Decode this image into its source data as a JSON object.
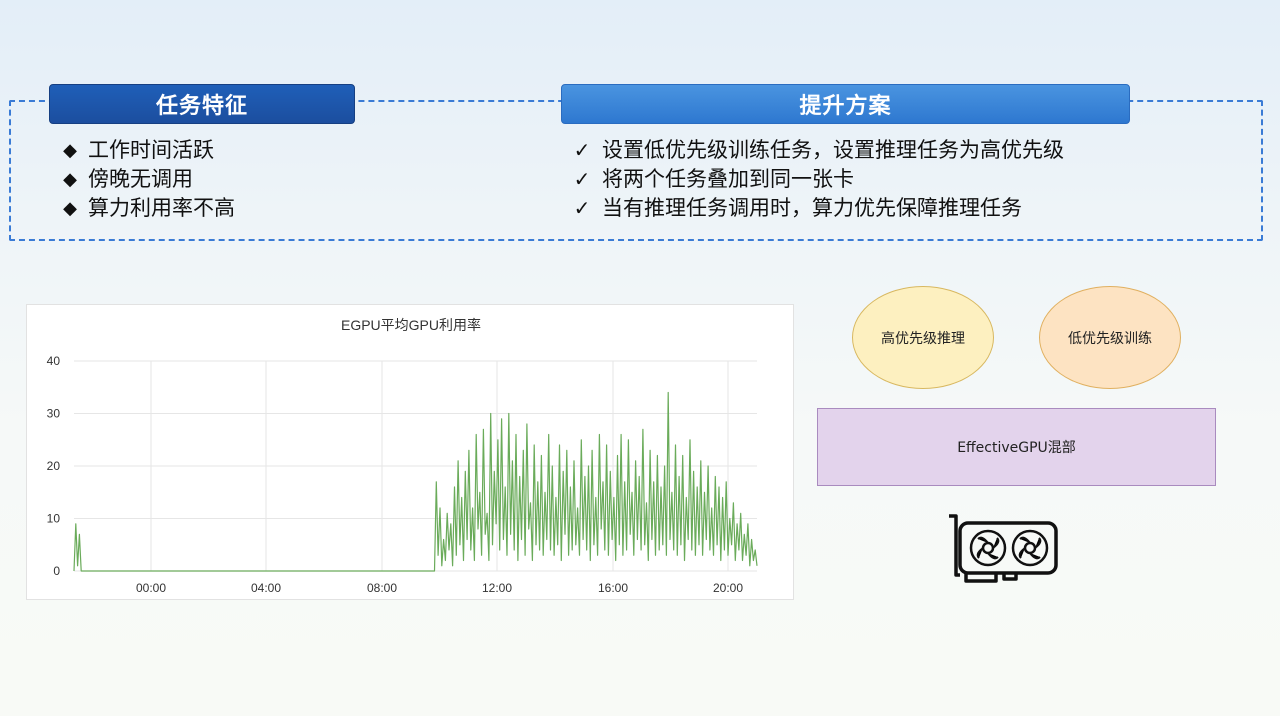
{
  "left_section": {
    "title": "任务特征",
    "items": [
      "工作时间活跃",
      "傍晚无调用",
      "算力利用率不高"
    ]
  },
  "right_section": {
    "title": "提升方案",
    "items": [
      "设置低优先级训练任务，设置推理任务为高优先级",
      "将两个任务叠加到同一张卡",
      "当有推理任务调用时，算力优先保障推理任务"
    ]
  },
  "chart_data": {
    "type": "line",
    "title": "EGPU平均GPU利用率",
    "xlabel": "",
    "ylabel": "",
    "ylim": [
      0,
      40
    ],
    "y_ticks": [
      "0",
      "10",
      "20",
      "30",
      "40"
    ],
    "x_ticks": [
      "00:00",
      "04:00",
      "08:00",
      "12:00",
      "16:00",
      "20:00"
    ],
    "grid": true,
    "series_color": "#6aab5a",
    "series": [
      {
        "values": [
          0,
          9,
          1,
          7,
          0,
          0,
          0,
          0,
          0,
          0,
          0,
          0,
          0,
          0,
          0,
          0,
          0,
          0,
          0,
          0,
          0,
          0,
          0,
          0,
          0,
          0,
          0,
          0,
          0,
          0,
          0,
          0,
          0,
          0,
          0,
          0,
          0,
          0,
          0,
          0,
          0,
          0,
          0,
          0,
          0,
          0,
          0,
          0,
          0,
          0,
          0,
          0,
          0,
          0,
          0,
          0,
          0,
          0,
          0,
          0,
          0,
          0,
          0,
          0,
          0,
          0,
          0,
          0,
          0,
          0,
          0,
          0,
          0,
          0,
          0,
          0,
          0,
          0,
          0,
          0,
          0,
          0,
          0,
          0,
          0,
          0,
          0,
          0,
          0,
          0,
          0,
          0,
          0,
          0,
          0,
          0,
          0,
          0,
          0,
          0,
          0,
          0,
          0,
          0,
          0,
          0,
          0,
          0,
          0,
          0,
          0,
          0,
          0,
          0,
          0,
          0,
          0,
          0,
          0,
          0,
          0,
          0,
          0,
          0,
          0,
          0,
          0,
          0,
          0,
          0,
          0,
          0,
          0,
          0,
          0,
          0,
          0,
          0,
          0,
          0,
          0,
          0,
          0,
          0,
          0,
          0,
          0,
          0,
          0,
          0,
          0,
          0,
          0,
          0,
          0,
          0,
          0,
          0,
          0,
          0,
          0,
          0,
          0,
          0,
          0,
          0,
          0,
          0,
          0,
          0,
          0,
          0,
          0,
          0,
          0,
          0,
          0,
          0,
          0,
          0,
          0,
          0,
          0,
          0,
          0,
          0,
          0,
          0,
          0,
          0,
          0,
          0,
          0,
          0,
          0,
          0,
          0,
          0,
          0,
          0,
          17,
          3,
          12,
          1,
          6,
          2,
          11,
          4,
          9,
          1,
          16,
          3,
          21,
          5,
          14,
          2,
          19,
          6,
          23,
          4,
          12,
          2,
          26,
          8,
          15,
          3,
          27,
          7,
          11,
          2,
          30,
          5,
          19,
          9,
          25,
          4,
          29,
          6,
          16,
          3,
          30,
          7,
          21,
          4,
          26,
          2,
          18,
          6,
          23,
          3,
          28,
          8,
          13,
          2,
          24,
          5,
          17,
          4,
          22,
          3,
          15,
          6,
          26,
          4,
          20,
          3,
          14,
          5,
          24,
          2,
          19,
          7,
          23,
          3,
          16,
          4,
          21,
          5,
          12,
          3,
          25,
          6,
          18,
          4,
          20,
          2,
          23,
          5,
          14,
          3,
          26,
          8,
          17,
          4,
          24,
          3,
          19,
          6,
          14,
          2,
          22,
          5,
          26,
          3,
          17,
          4,
          25,
          7,
          15,
          3,
          21,
          6,
          18,
          4,
          27,
          5,
          13,
          2,
          23,
          6,
          17,
          3,
          22,
          4,
          16,
          5,
          20,
          3,
          34,
          6,
          15,
          4,
          24,
          3,
          18,
          5,
          22,
          2,
          14,
          6,
          25,
          4,
          19,
          3,
          16,
          5,
          21,
          3,
          15,
          6,
          20,
          4,
          12,
          3,
          18,
          5,
          16,
          2,
          14,
          4,
          17,
          3,
          10,
          5,
          13,
          2,
          9,
          4,
          11,
          2,
          7,
          3,
          9,
          1,
          6,
          2,
          4,
          1
        ]
      }
    ]
  },
  "diagram": {
    "high_priority_label": "高优先级推理",
    "low_priority_label": "低优先级训练",
    "mix_label": "EffectiveGPU混部",
    "gpu_icon": "gpu-card-icon"
  }
}
